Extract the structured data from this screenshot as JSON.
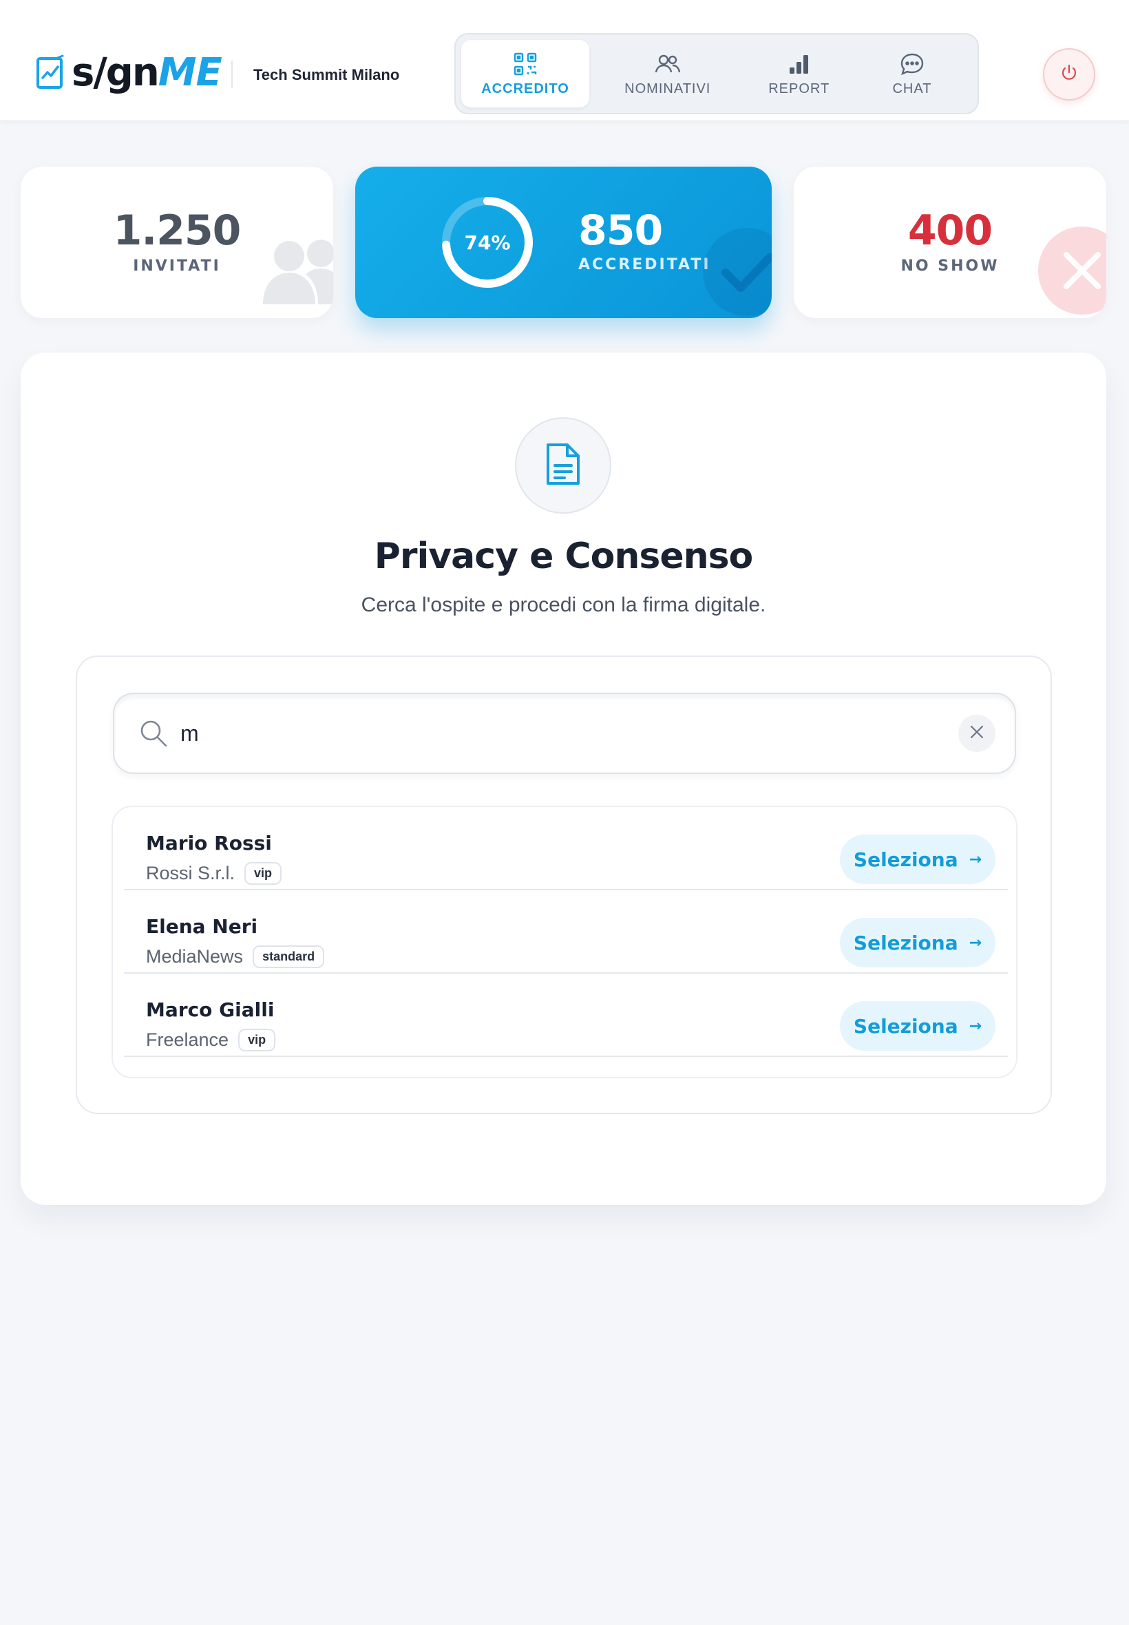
{
  "app": {
    "logo_text_sign": "s/gn",
    "logo_text_me": "ME",
    "event_name": "Tech Summit Milano"
  },
  "nav": {
    "items": [
      {
        "label": "ACCREDITO",
        "icon": "qr-code-icon",
        "active": true
      },
      {
        "label": "NOMINATIVI",
        "icon": "users-icon",
        "active": false
      },
      {
        "label": "REPORT",
        "icon": "bar-chart-icon",
        "active": false
      },
      {
        "label": "CHAT",
        "icon": "chat-bubble-icon",
        "active": false
      }
    ]
  },
  "power_button": {
    "icon": "power-icon"
  },
  "stats": {
    "invited": {
      "value": "1.250",
      "label": "INVITATI",
      "icon": "users-icon"
    },
    "accredited": {
      "value": "850",
      "label": "ACCREDITATI",
      "percent_text": "74%",
      "percent": 74,
      "icon": "check-icon"
    },
    "no_show": {
      "value": "400",
      "label": "NO SHOW",
      "icon": "close-icon"
    }
  },
  "main": {
    "icon": "document-icon",
    "title": "Privacy e Consenso",
    "subtitle": "Cerca l'ospite e procedi con la firma digitale."
  },
  "search": {
    "value": "m",
    "placeholder": ""
  },
  "results": [
    {
      "name": "Mario Rossi",
      "company": "Rossi S.r.l.",
      "badge": "vip",
      "action": "Seleziona"
    },
    {
      "name": "Elena Neri",
      "company": "MediaNews",
      "badge": "standard",
      "action": "Seleziona"
    },
    {
      "name": "Marco Gialli",
      "company": "Freelance",
      "badge": "vip",
      "action": "Seleziona"
    }
  ],
  "colors": {
    "accent": "#169fdc",
    "danger": "#d7303c",
    "background": "#f4f6fa"
  }
}
